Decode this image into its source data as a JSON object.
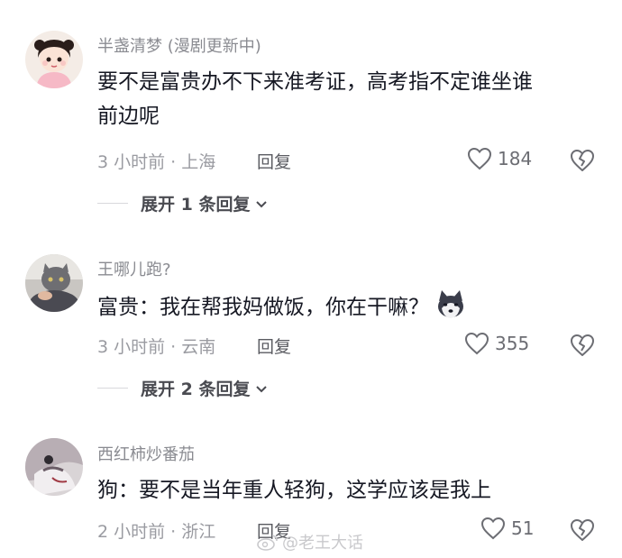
{
  "comments": [
    {
      "username": "半盏清梦 (漫剧更新中)",
      "text_line1": "要不是富贵办不下来准考证，高考指不定谁坐谁",
      "text_line2": "前边呢",
      "meta": "3 小时前 · 上海",
      "reply_label": "回复",
      "likes": "184",
      "expand_label": "展开 1 条回复"
    },
    {
      "username": "王哪儿跑?",
      "text": "富贵：我在帮我妈做饭，你在干嘛？",
      "meta": "3 小时前 · 云南",
      "reply_label": "回复",
      "likes": "355",
      "expand_label": "展开 2 条回复"
    },
    {
      "username": "西红柿炒番茄",
      "text": "狗：要不是当年重人轻狗，这学应该是我上",
      "meta": "2 小时前 · 浙江",
      "reply_label": "回复",
      "likes": "51"
    }
  ],
  "watermark": "@老王大话",
  "colors": {
    "text": "#161823",
    "muted": "#9a9ba1",
    "icon": "#6c6d73"
  },
  "icons": [
    "heart-icon",
    "broken-heart-icon",
    "chevron-down-icon",
    "husky-emoji-icon",
    "weibo-logo-icon"
  ]
}
